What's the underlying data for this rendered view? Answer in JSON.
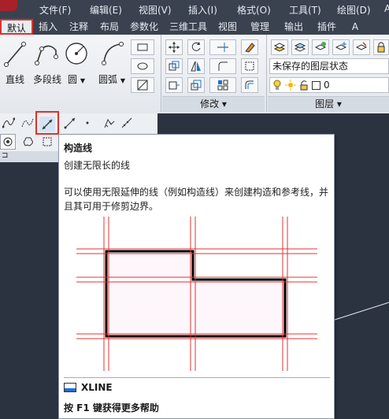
{
  "menubar": {
    "items": [
      "文件(F)",
      "编辑(E)",
      "视图(V)",
      "插入(I)",
      "格式(O)",
      "工具(T)",
      "绘图(D)",
      "Au"
    ]
  },
  "tabs": [
    {
      "label": "默认",
      "active": true
    },
    {
      "label": "插入",
      "active": false
    },
    {
      "label": "注释",
      "active": false
    },
    {
      "label": "布局",
      "active": false
    },
    {
      "label": "参数化",
      "active": false
    },
    {
      "label": "三维工具",
      "active": false
    },
    {
      "label": "视图",
      "active": false
    },
    {
      "label": "管理",
      "active": false
    },
    {
      "label": "输出",
      "active": false
    },
    {
      "label": "插件",
      "active": false
    },
    {
      "label": "A",
      "active": false
    }
  ],
  "draw_panel": {
    "tools": [
      {
        "label": "直线",
        "icon": "line-icon"
      },
      {
        "label": "多段线",
        "icon": "polyline-icon"
      },
      {
        "label": "圆",
        "icon": "circle-icon"
      },
      {
        "label": "圆弧",
        "icon": "arc-icon"
      }
    ]
  },
  "modify_panel": {
    "title": "修改"
  },
  "layers_panel": {
    "title": "图层",
    "state_field": "未保存的图层状态",
    "layer_name": "0"
  },
  "tooltip": {
    "title": "构造线",
    "subtitle": "创建无限长的线",
    "description": "可以使用无限延伸的线（例如构造线）来创建构造和参考线，并且其可用于修剪边界。",
    "command": "XLINE",
    "help": "按 F1 键获得更多帮助"
  },
  "colors": {
    "highlight": "#e0302b",
    "ribbon_bg": "#e9edf2",
    "canvas_bg": "#2b3341",
    "construction_line": "#e03535"
  }
}
